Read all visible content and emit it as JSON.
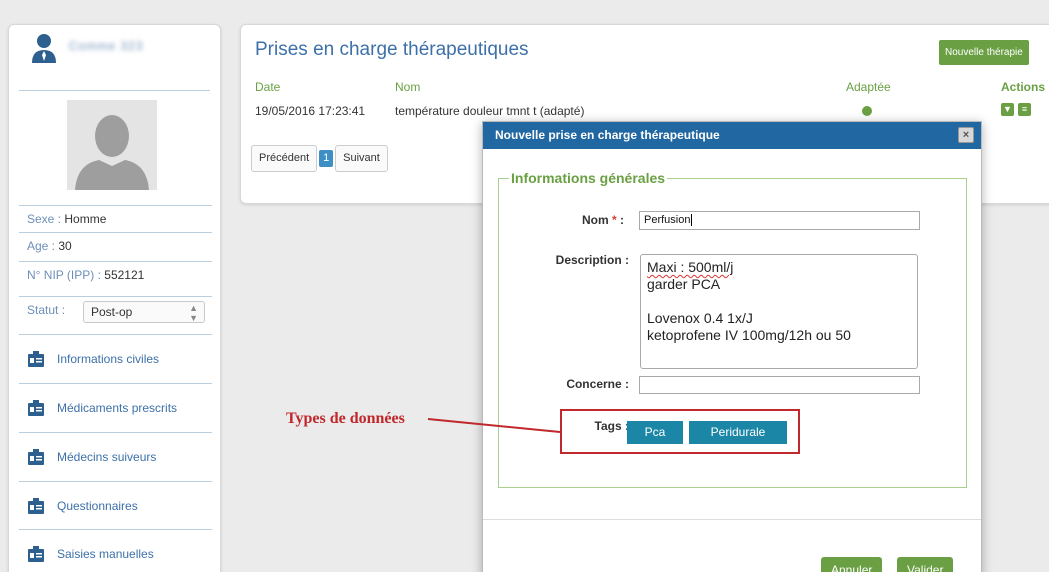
{
  "sidebar": {
    "patient_name": "Comme 323",
    "sexe_label": "Sexe : ",
    "sexe_value": "Homme",
    "age_label": "Age : ",
    "age_value": "30",
    "nip_label": "N° NIP (IPP) : ",
    "nip_value": "552121",
    "statut_label": "Statut :",
    "statut_value": "Post-op",
    "nav": [
      {
        "label": "Informations civiles",
        "icon": "id-card-icon"
      },
      {
        "label": "Médicaments prescrits",
        "icon": "id-card-icon"
      },
      {
        "label": "Médecins suiveurs",
        "icon": "id-card-icon"
      },
      {
        "label": "Questionnaires",
        "icon": "id-card-icon"
      },
      {
        "label": "Saisies manuelles",
        "icon": "id-card-icon"
      }
    ]
  },
  "main": {
    "title": "Prises en charge thérapeutiques",
    "new_button": "Nouvelle thérapie",
    "columns": {
      "date": "Date",
      "nom": "Nom",
      "adaptee": "Adaptée",
      "actions": "Actions"
    },
    "rows": [
      {
        "date": "19/05/2016 17:23:41",
        "nom": "température douleur tmnt t (adapté)",
        "adaptee": true
      }
    ],
    "pager": {
      "prev": "Précédent",
      "page": "1",
      "next": "Suivant"
    }
  },
  "modal": {
    "title": "Nouvelle prise en charge thérapeutique",
    "close": "×",
    "legend": "Informations générales",
    "nom_label": "Nom",
    "required_mark": "*",
    "colon": ":",
    "nom_value": "Perfusion",
    "description_label": "Description :",
    "description_lines": [
      "Maxi : 500ml/j",
      "garder PCA",
      "",
      "Lovenox 0.4 1x/J",
      "ketoprofene IV 100mg/12h ou 50"
    ],
    "concerne_label": "Concerne :",
    "concerne_value": "",
    "tags_label": "Tags :",
    "tags": [
      "Pca",
      "Peridurale"
    ],
    "cancel": "Annuler",
    "submit": "Valider"
  },
  "annotation": {
    "label": "Types de données",
    "color": "#c0282b"
  },
  "colors": {
    "accent_blue": "#3d70a8",
    "accent_green": "#6aa043",
    "modal_header": "#2167a1",
    "tag": "#1c86a7"
  }
}
